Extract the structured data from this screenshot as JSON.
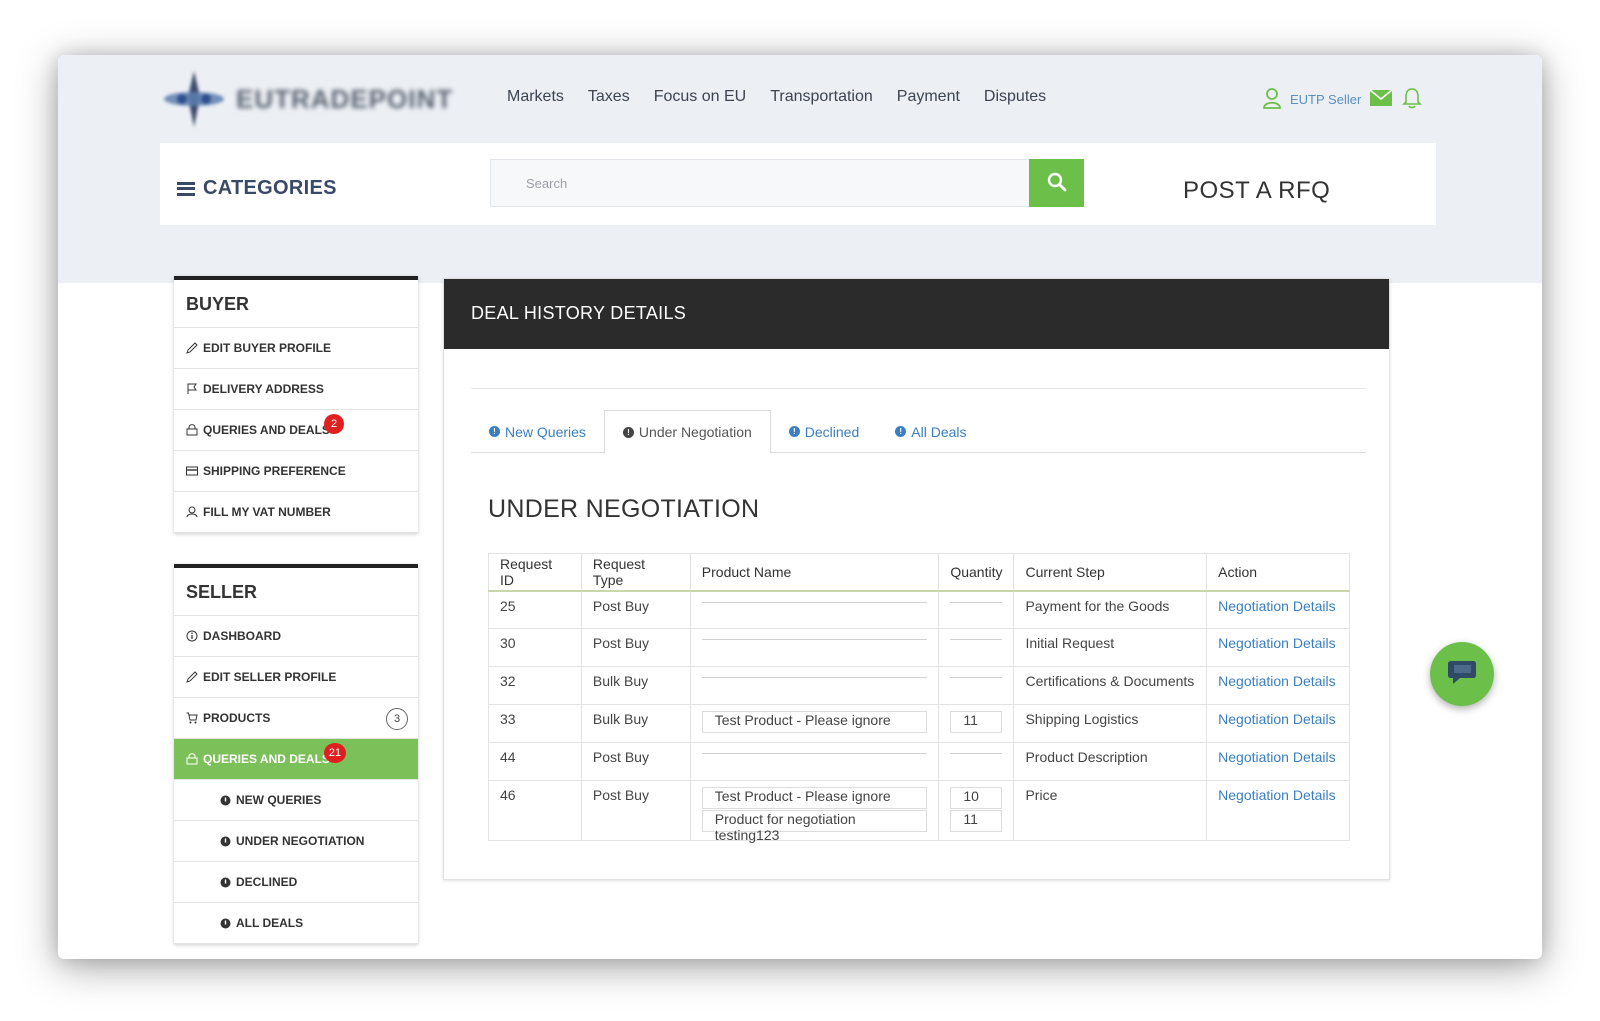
{
  "header": {
    "logo_text": "EUTRADEPOINT",
    "nav": [
      "Markets",
      "Taxes",
      "Focus on EU",
      "Transportation",
      "Payment",
      "Disputes"
    ],
    "user_label": "EUTP Seller"
  },
  "searchbar": {
    "categories_label": "CATEGORIES",
    "search_placeholder": "Search",
    "rfq_label": "POST A RFQ"
  },
  "buyer": {
    "title": "BUYER",
    "items": [
      {
        "label": "EDIT BUYER PROFILE",
        "icon": "pencil-icon"
      },
      {
        "label": "DELIVERY ADDRESS",
        "icon": "flag-icon"
      },
      {
        "label": "QUERIES AND DEALS",
        "icon": "bag-icon",
        "badge": "2"
      },
      {
        "label": "SHIPPING PREFERENCE",
        "icon": "card-icon"
      },
      {
        "label": "FILL MY VAT NUMBER",
        "icon": "user-icon"
      }
    ]
  },
  "seller": {
    "title": "SELLER",
    "items": [
      {
        "label": "DASHBOARD",
        "icon": "info-icon"
      },
      {
        "label": "EDIT SELLER PROFILE",
        "icon": "pencil-icon"
      },
      {
        "label": "PRODUCTS",
        "icon": "cart-icon",
        "count": "3"
      },
      {
        "label": "QUERIES AND DEALS",
        "icon": "bag-icon",
        "badge": "21",
        "active": true
      },
      {
        "label": "NEW QUERIES",
        "icon": "dot-icon"
      },
      {
        "label": "UNDER NEGOTIATION",
        "icon": "dot-icon"
      },
      {
        "label": "DECLINED",
        "icon": "dot-icon"
      },
      {
        "label": "ALL DEALS",
        "icon": "dot-icon"
      }
    ]
  },
  "main": {
    "header_title": "DEAL HISTORY DETAILS",
    "tabs": [
      {
        "label": "New Queries",
        "active": false
      },
      {
        "label": "Under Negotiation",
        "active": true
      },
      {
        "label": "Declined",
        "active": false
      },
      {
        "label": "All Deals",
        "active": false
      }
    ],
    "section_title": "UNDER NEGOTIATION",
    "table": {
      "columns": [
        "Request ID",
        "Request Type",
        "Product Name",
        "Quantity",
        "Current Step",
        "Action"
      ],
      "rows": [
        {
          "id": "25",
          "type": "Post Buy",
          "products": [
            ""
          ],
          "quantities": [
            ""
          ],
          "step": "Payment for the Goods",
          "action": "Negotiation Details"
        },
        {
          "id": "30",
          "type": "Post Buy",
          "products": [
            ""
          ],
          "quantities": [
            ""
          ],
          "step": "Initial Request",
          "action": "Negotiation Details"
        },
        {
          "id": "32",
          "type": "Bulk Buy",
          "products": [
            ""
          ],
          "quantities": [
            ""
          ],
          "step": "Certifications & Documents",
          "action": "Negotiation Details"
        },
        {
          "id": "33",
          "type": "Bulk Buy",
          "products": [
            "Test Product - Please ignore"
          ],
          "quantities": [
            "11"
          ],
          "step": "Shipping Logistics",
          "action": "Negotiation Details"
        },
        {
          "id": "44",
          "type": "Post Buy",
          "products": [
            ""
          ],
          "quantities": [
            ""
          ],
          "step": "Product Description",
          "action": "Negotiation Details"
        },
        {
          "id": "46",
          "type": "Post Buy",
          "products": [
            "Test Product - Please ignore",
            "Product for negotiation testing123"
          ],
          "quantities": [
            "10",
            "11"
          ],
          "step": "Price",
          "action": "Negotiation Details"
        }
      ]
    }
  },
  "colors": {
    "accent_green": "#6cc04a",
    "active_green": "#7cc05a",
    "link_blue": "#3a7fc1",
    "header_dark": "#2b2b2b",
    "badge_red": "#e02020"
  }
}
